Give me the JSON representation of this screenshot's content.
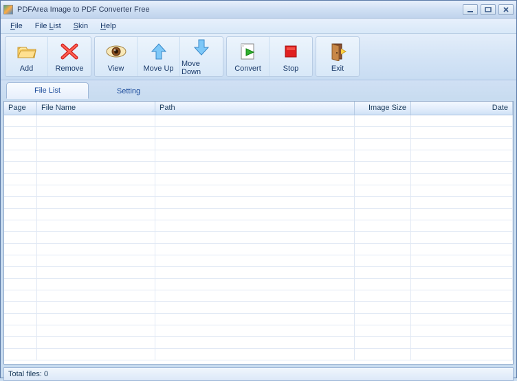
{
  "window": {
    "title": "PDFArea Image to PDF Converter Free"
  },
  "menubar": {
    "file": "File",
    "filelist": "File List",
    "skin": "Skin",
    "help": "Help"
  },
  "toolbar": {
    "add": "Add",
    "remove": "Remove",
    "view": "View",
    "moveup": "Move Up",
    "movedown": "Move Down",
    "convert": "Convert",
    "stop": "Stop",
    "exit": "Exit"
  },
  "tabs": {
    "filelist": "File List",
    "setting": "Setting",
    "active": "filelist"
  },
  "columns": {
    "page": "Page",
    "filename": "File Name",
    "path": "Path",
    "imagesize": "Image Size",
    "date": "Date"
  },
  "rows": [],
  "status": {
    "text": "Total files: 0"
  }
}
